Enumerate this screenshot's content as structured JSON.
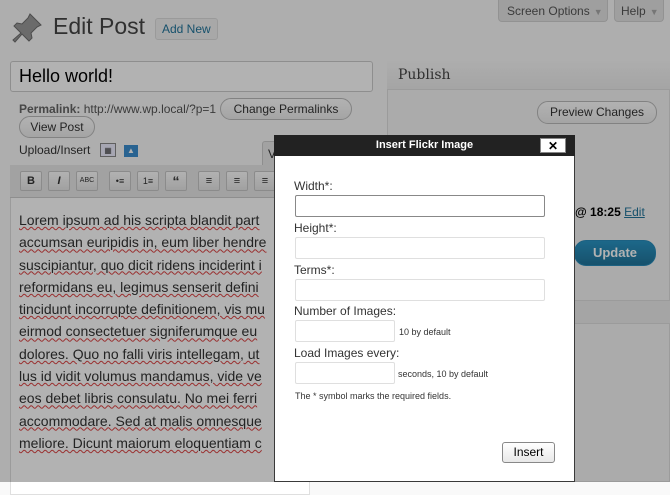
{
  "header": {
    "page_title": "Edit Post",
    "add_new": "Add New",
    "screen_options": "Screen Options",
    "help": "Help"
  },
  "post": {
    "title": "Hello world!",
    "permalink_label": "Permalink:",
    "permalink_url": "http://www.wp.local/?p=1",
    "change_permalinks": "Change Permalinks",
    "view_post": "View Post",
    "upload_label": "Upload/Insert"
  },
  "editor": {
    "visual_tab": "V",
    "toolbar": [
      "B",
      "I",
      "ABC",
      "•≡",
      "1≡",
      "“",
      "≡",
      "≡",
      "≡"
    ],
    "lines": [
      "Lorem ipsum ad his scripta blandit part",
      "accumsan euripidis in, eum liber hendre",
      "suscipiantur, quo dicit ridens inciderint i",
      "reformidans eu, legimus senserit defini",
      "tincidunt incorrupte definitionem, vis mu",
      "eirmod consectetuer signiferumque eu",
      "dolores. Quo no falli viris intellegam, ut",
      "lus id vidit volumus mandamus, vide ve",
      "eos debet libris consulatu. No mei ferri",
      "accommodare. Sed at malis omnesque",
      "meliore. Dicunt maiorum eloquentiam c"
    ]
  },
  "sidebar": {
    "publish_title": "Publish",
    "preview_changes": "Preview Changes",
    "date_prefix": "@ ",
    "date_time": "18:25",
    "edit": "Edit",
    "update": "Update"
  },
  "modal": {
    "title": "Insert Flickr Image",
    "close": "✕",
    "width_label": "Width*:",
    "height_label": "Height*:",
    "terms_label": "Terms*:",
    "num_images_label": "Number of Images:",
    "num_images_hint": "10 by default",
    "load_every_label": "Load Images every:",
    "load_every_hint": "seconds, 10 by default",
    "required_note": "The * symbol marks the required fields.",
    "insert": "Insert",
    "width_value": "",
    "height_value": "",
    "terms_value": "",
    "num_images_value": "",
    "load_every_value": ""
  }
}
